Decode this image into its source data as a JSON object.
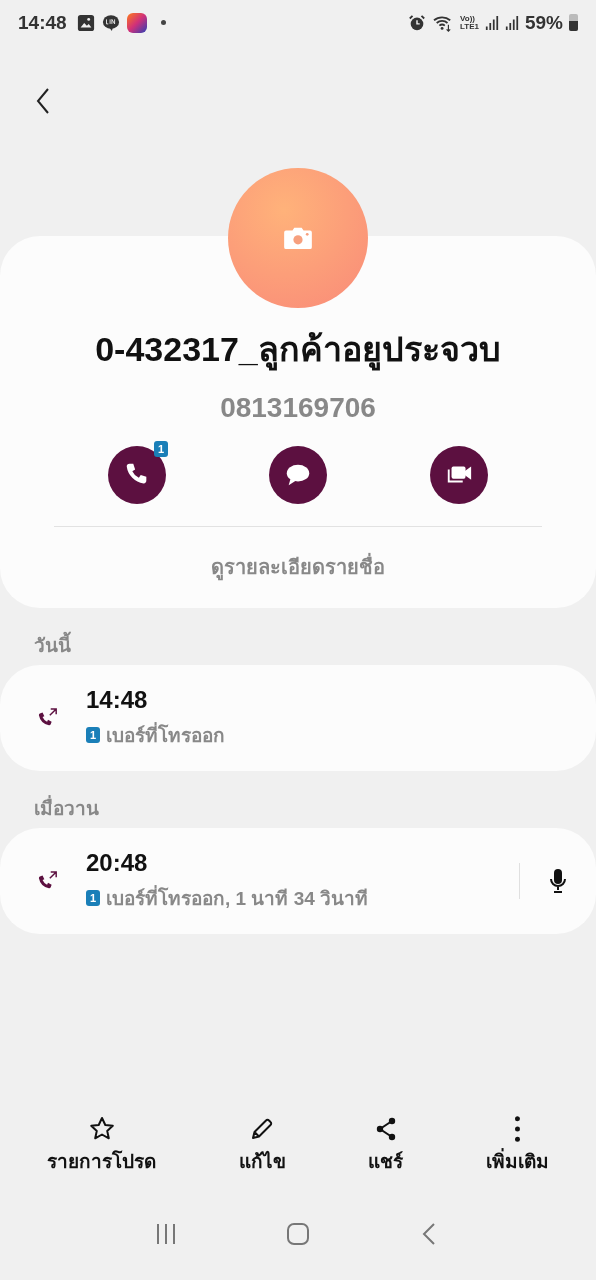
{
  "status_bar": {
    "time": "14:48",
    "notification_icons": [
      {
        "kind": "gallery"
      },
      {
        "kind": "line"
      },
      {
        "kind": "laz"
      },
      {
        "kind": "dot"
      }
    ],
    "volte": "Vo))",
    "network": "LTE1",
    "battery": "59%"
  },
  "contact": {
    "name": "0-432317_ลูกค้าอยูประจวบ",
    "number": "0813169706",
    "actions": [
      {
        "kind": "call",
        "badge": "1"
      },
      {
        "kind": "message"
      },
      {
        "kind": "video"
      }
    ],
    "details_link": "ดูรายละเอียดรายชื่อ"
  },
  "call_groups": [
    {
      "heading": "วันนี้",
      "calls": [
        {
          "kind": "outgoing",
          "time": "14:48",
          "sim": "1",
          "description": "เบอร์ที่โทรออก",
          "recording": false
        }
      ]
    },
    {
      "heading": "เมื่อวาน",
      "calls": [
        {
          "kind": "outgoing",
          "time": "20:48",
          "sim": "1",
          "description": "เบอร์ที่โทรออก, 1 นาที 34 วินาที",
          "recording": true
        }
      ]
    }
  ],
  "bottom_actions": [
    {
      "kind": "favorite",
      "label": "รายการโปรด"
    },
    {
      "kind": "edit",
      "label": "แก้ไข"
    },
    {
      "kind": "share",
      "label": "แชร์"
    },
    {
      "kind": "more",
      "label": "เพิ่มเติม"
    }
  ],
  "nav_bar": [
    {
      "kind": "recents"
    },
    {
      "kind": "home"
    },
    {
      "kind": "back"
    }
  ]
}
